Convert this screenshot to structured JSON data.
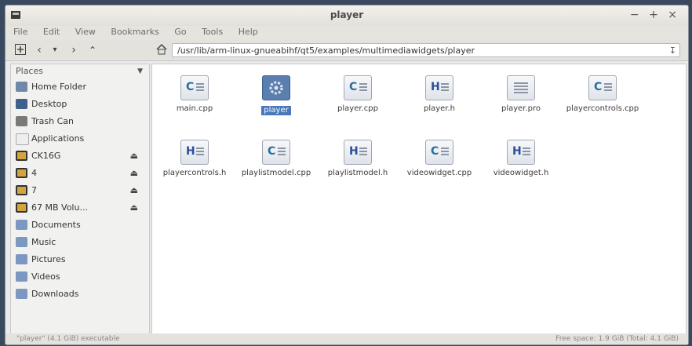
{
  "window": {
    "title": "player",
    "controls": [
      "−",
      "+",
      "×"
    ]
  },
  "menu": [
    "File",
    "Edit",
    "View",
    "Bookmarks",
    "Go",
    "Tools",
    "Help"
  ],
  "toolbar": {
    "path": "/usr/lib/arm-linux-gnueabihf/qt5/examples/multimediawidgets/player"
  },
  "sidebar": {
    "header": "Places",
    "items": [
      {
        "label": "Home Folder",
        "icon": "home-folder-icon",
        "eject": false
      },
      {
        "label": "Desktop",
        "icon": "desktop-icon",
        "eject": false
      },
      {
        "label": "Trash Can",
        "icon": "trash-icon",
        "eject": false
      },
      {
        "label": "Applications",
        "icon": "applications-icon",
        "eject": false
      },
      {
        "label": "CK16G",
        "icon": "drive-icon",
        "eject": true
      },
      {
        "label": "4",
        "icon": "drive-icon",
        "eject": true
      },
      {
        "label": "7",
        "icon": "drive-icon",
        "eject": true
      },
      {
        "label": "67 MB Volu...",
        "icon": "drive-icon",
        "eject": true
      },
      {
        "label": "Documents",
        "icon": "documents-folder-icon",
        "eject": false
      },
      {
        "label": "Music",
        "icon": "music-folder-icon",
        "eject": false
      },
      {
        "label": "Pictures",
        "icon": "pictures-folder-icon",
        "eject": false
      },
      {
        "label": "Videos",
        "icon": "videos-folder-icon",
        "eject": false
      },
      {
        "label": "Downloads",
        "icon": "downloads-folder-icon",
        "eject": false
      }
    ]
  },
  "files": [
    {
      "name": "main.cpp",
      "type": "C"
    },
    {
      "name": "player",
      "type": "exec",
      "selected": true
    },
    {
      "name": "player.cpp",
      "type": "C"
    },
    {
      "name": "player.h",
      "type": "H"
    },
    {
      "name": "player.pro",
      "type": "text"
    },
    {
      "name": "playercontrols.cpp",
      "type": "C"
    },
    {
      "name": "playercontrols.h",
      "type": "H"
    },
    {
      "name": "playlistmodel.cpp",
      "type": "C"
    },
    {
      "name": "playlistmodel.h",
      "type": "H"
    },
    {
      "name": "videowidget.cpp",
      "type": "C"
    },
    {
      "name": "videowidget.h",
      "type": "H"
    }
  ],
  "status": {
    "right": "Free space: 1.9 GiB (Total: 4.1 GiB)",
    "left": "\"player\" (4.1 GiB) executable"
  },
  "colors": {
    "h_label": "#2a4f9a",
    "c_label": "#2a6f9a",
    "selection": "#4a78b8"
  }
}
